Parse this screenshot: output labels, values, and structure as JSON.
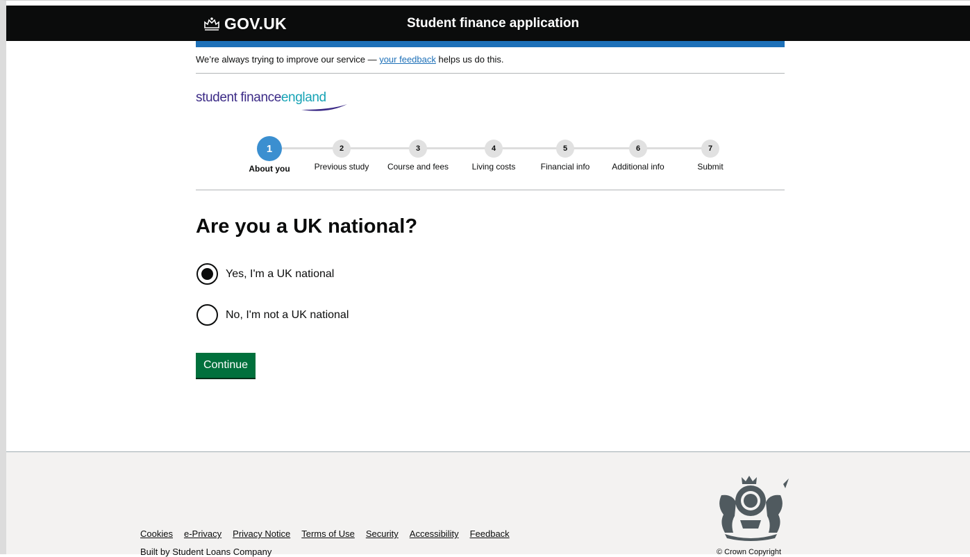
{
  "header": {
    "logo_text": "GOV.UK",
    "service_name": "Student finance application"
  },
  "feedback": {
    "prefix": "We’re always trying to improve our service —",
    "link_text": "your feedback",
    "suffix": "helps us do this."
  },
  "brand": {
    "part1": "student finance",
    "part2": "england"
  },
  "steps": [
    {
      "number": "1",
      "label": "About you",
      "active": true
    },
    {
      "number": "2",
      "label": "Previous study",
      "active": false
    },
    {
      "number": "3",
      "label": "Course and fees",
      "active": false
    },
    {
      "number": "4",
      "label": "Living costs",
      "active": false
    },
    {
      "number": "5",
      "label": "Financial info",
      "active": false
    },
    {
      "number": "6",
      "label": "Additional info",
      "active": false
    },
    {
      "number": "7",
      "label": "Submit",
      "active": false
    }
  ],
  "question": {
    "title": "Are you a UK national?",
    "options": [
      {
        "label": "Yes, I'm a UK national",
        "selected": true
      },
      {
        "label": "No, I'm not a UK national",
        "selected": false
      }
    ]
  },
  "continue_label": "Continue",
  "footer": {
    "links": [
      "Cookies",
      "e-Privacy",
      "Privacy Notice",
      "Terms of Use",
      "Security",
      "Accessibility",
      "Feedback"
    ],
    "built_by": "Built by Student Loans Company",
    "copyright": "© Crown Copyright"
  },
  "colors": {
    "header_bg": "#0b0c0c",
    "blue_bar": "#1d70b8",
    "active_step": "#3b8fd0",
    "button_green": "#00703c",
    "footer_bg": "#f3f2f1"
  }
}
